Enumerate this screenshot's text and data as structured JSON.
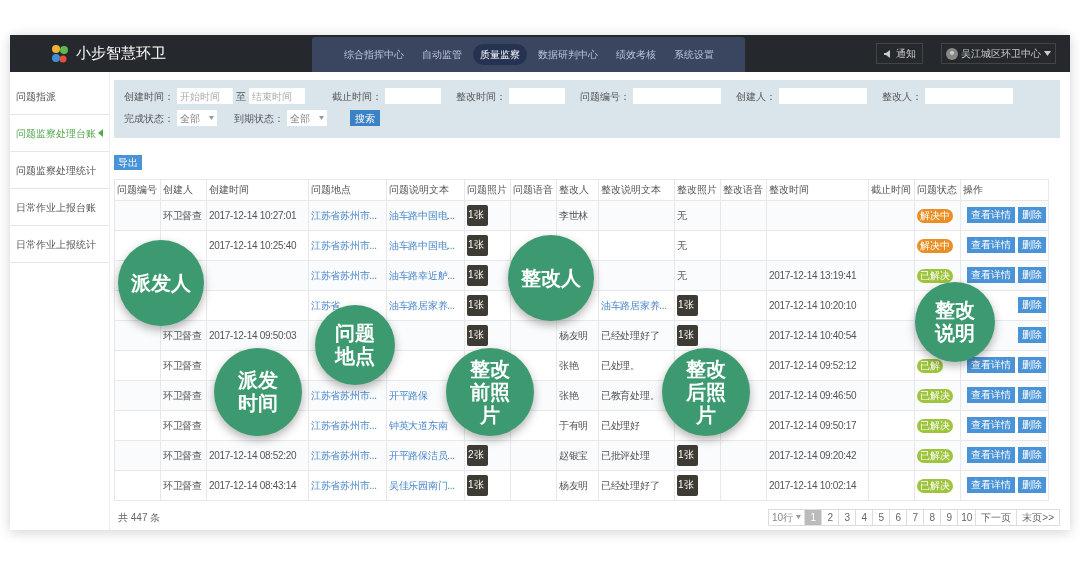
{
  "header": {
    "brand": "小步智慧环卫",
    "nav": [
      {
        "label": "综合指挥中心",
        "selected": false
      },
      {
        "label": "自动监管",
        "selected": false
      },
      {
        "label": "质量监察",
        "selected": true
      },
      {
        "label": "数据研判中心",
        "selected": false
      },
      {
        "label": "绩效考核",
        "selected": false
      },
      {
        "label": "系统设置",
        "selected": false
      }
    ],
    "notice": "通知",
    "user": "吴江城区环卫中心"
  },
  "sidebar": {
    "items": [
      {
        "label": "问题指派",
        "selected": false
      },
      {
        "label": "问题监察处理台账",
        "selected": true
      },
      {
        "label": "问题监察处理统计",
        "selected": false
      },
      {
        "label": "日常作业上报台账",
        "selected": false
      },
      {
        "label": "日常作业上报统计",
        "selected": false
      }
    ]
  },
  "filters": {
    "created_label": "创建时间：",
    "start_placeholder": "开始时间",
    "to": "至",
    "end_placeholder": "结束时间",
    "fields": [
      {
        "label": "截止时间："
      },
      {
        "label": "整改时间："
      },
      {
        "label": "问题编号："
      },
      {
        "label": "创建人："
      },
      {
        "label": "整改人："
      }
    ],
    "selects": [
      {
        "label": "完成状态：",
        "value": "全部"
      },
      {
        "label": "到期状态：",
        "value": "全部"
      }
    ],
    "search": "搜索"
  },
  "export": "导出",
  "table": {
    "columns": [
      "问题编号",
      "创建人",
      "创建时间",
      "问题地点",
      "问题说明文本",
      "问题照片",
      "问题语音",
      "整改人",
      "整改说明文本",
      "整改照片",
      "整改语音",
      "整改时间",
      "截止时间",
      "问题状态",
      "操作"
    ],
    "rows": [
      {
        "creator": "环卫督查",
        "created": "2017-12-14 10:27:01",
        "location": "江苏省苏州市...",
        "description": "油车路中国电...",
        "photo": {
          "kind": "thumb",
          "text": "1张"
        },
        "rectifier": "李世林",
        "rect_photo": {
          "kind": "none",
          "text": "无"
        },
        "status": {
          "text": "解决中",
          "color": "#e98f25"
        },
        "actions": [
          "查看详情",
          "删除"
        ]
      },
      {
        "created": "2017-12-14 10:25:40",
        "location": "江苏省苏州市...",
        "description": "油车路中国电...",
        "photo": {
          "kind": "thumb",
          "text": "1张"
        },
        "rect_photo": {
          "kind": "none",
          "text": "无"
        },
        "status": {
          "text": "解决中",
          "color": "#e98f25"
        },
        "actions": [
          "查看详情",
          "删除"
        ]
      },
      {
        "location": "江苏省苏州市...",
        "description": "油车路幸近舻...",
        "photo": {
          "kind": "thumb",
          "text": "1张"
        },
        "rect_photo": {
          "kind": "none",
          "text": "无"
        },
        "rect_time": "2017-12-14 13:19:41",
        "status": {
          "text": "已解决",
          "color": "#9dc43c"
        },
        "actions": [
          "查看详情",
          "删除"
        ]
      },
      {
        "location": "江苏省",
        "description": "油车路居家养...",
        "photo": {
          "kind": "thumb",
          "text": "1张"
        },
        "rect_note": {
          "kind": "link",
          "text": "油车路居家养..."
        },
        "rect_photo": {
          "kind": "thumb",
          "text": "1张"
        },
        "rect_time": "2017-12-14 10:20:10",
        "actions": [
          "删除"
        ]
      },
      {
        "creator": "环卫督查",
        "created": "2017-12-14 09:50:03",
        "photo": {
          "kind": "thumb",
          "text": "1张"
        },
        "rectifier": "杨友明",
        "rect_note": {
          "kind": "text",
          "text": "已经处理好了"
        },
        "rect_photo": {
          "kind": "thumb",
          "text": "1张"
        },
        "rect_time": "2017-12-14 10:40:54",
        "actions": [
          "删除"
        ]
      },
      {
        "creator": "环卫督查",
        "rectifier": "张艳",
        "rect_note": {
          "kind": "text",
          "text": "已处理。"
        },
        "rect_time": "2017-12-14 09:52:12",
        "status": {
          "text": "已解",
          "color": "#9dc43c"
        },
        "actions": [
          "查看详情",
          "删除"
        ]
      },
      {
        "creator": "环卫督查",
        "location": "江苏省苏州市...",
        "description": "开平路保",
        "rectifier": "张艳",
        "rect_note": {
          "kind": "text",
          "text": "已教育处理。"
        },
        "rect_time": "2017-12-14 09:46:50",
        "status": {
          "text": "已解决",
          "color": "#9dc43c"
        },
        "actions": [
          "查看详情",
          "删除"
        ]
      },
      {
        "creator": "环卫督查",
        "location": "江苏省苏州市...",
        "description": "钟英大道东南",
        "rectifier": "于有明",
        "rect_note": {
          "kind": "text",
          "text": "已处理好"
        },
        "rect_time": "2017-12-14 09:50:17",
        "status": {
          "text": "已解决",
          "color": "#9dc43c"
        },
        "actions": [
          "查看详情",
          "删除"
        ]
      },
      {
        "creator": "环卫督查",
        "created": "2017-12-14 08:52:20",
        "location": "江苏省苏州市...",
        "description": "开平路保洁员...",
        "photo": {
          "kind": "thumb",
          "text": "2张"
        },
        "rectifier": "赵银宝",
        "rect_note": {
          "kind": "text",
          "text": "已批评处理"
        },
        "rect_photo": {
          "kind": "thumb",
          "text": "1张"
        },
        "rect_time": "2017-12-14 09:20:42",
        "status": {
          "text": "已解决",
          "color": "#9dc43c"
        },
        "actions": [
          "查看详情",
          "删除"
        ]
      },
      {
        "creator": "环卫督查",
        "created": "2017-12-14 08:43:14",
        "location": "江苏省苏州市...",
        "description": "吴佳乐园南门...",
        "photo": {
          "kind": "thumb",
          "text": "1张"
        },
        "rectifier": "杨友明",
        "rect_note": {
          "kind": "text",
          "text": "已经处理好了"
        },
        "rect_photo": {
          "kind": "thumb",
          "text": "1张"
        },
        "rect_time": "2017-12-14 10:02:14",
        "status": {
          "text": "已解决",
          "color": "#9dc43c"
        },
        "actions": [
          "查看详情",
          "删除"
        ]
      }
    ]
  },
  "footer": {
    "total": "共 447 条",
    "page_size": "10行",
    "pages": [
      {
        "label": "1",
        "selected": true
      },
      {
        "label": "2",
        "selected": false
      },
      {
        "label": "3",
        "selected": false
      },
      {
        "label": "4",
        "selected": false
      },
      {
        "label": "5",
        "selected": false
      },
      {
        "label": "6",
        "selected": false
      },
      {
        "label": "7",
        "selected": false
      },
      {
        "label": "8",
        "selected": false
      },
      {
        "label": "9",
        "selected": false
      },
      {
        "label": "10",
        "selected": false
      }
    ],
    "next": "下一页",
    "last": "末页>>"
  },
  "callouts": [
    {
      "text": "派发人"
    },
    {
      "text": "问题地点"
    },
    {
      "text": "派发时间"
    },
    {
      "text": "整改前照片"
    },
    {
      "text": "整改人"
    },
    {
      "text": "整改后照片"
    },
    {
      "text": "整改说明"
    }
  ]
}
